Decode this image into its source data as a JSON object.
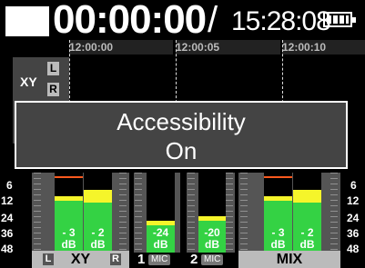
{
  "header": {
    "counter": "00:00:00",
    "separator": "/",
    "remaining": "15:28:08",
    "battery_icon": "battery-full-icon",
    "stop_icon": "stop-square-icon"
  },
  "timeline": {
    "ticks": [
      "12:00:00",
      "12:00:05",
      "12:00:10"
    ],
    "track_name": "XY",
    "left_badge": "L",
    "right_badge": "R"
  },
  "popup": {
    "line1": "Accessibility",
    "line2": "On"
  },
  "meters": {
    "scale_left": [
      "6",
      "12",
      "24",
      "36",
      "48"
    ],
    "scale_right": [
      "6",
      "12",
      "24",
      "36",
      "48"
    ],
    "channels": [
      {
        "level": "- 3",
        "unit": "dB",
        "fill": 0.7
      },
      {
        "level": "- 2",
        "unit": "dB",
        "fill": 0.78
      },
      {
        "level": "-24",
        "unit": "dB",
        "fill": 0.4
      },
      {
        "level": "-20",
        "unit": "dB",
        "fill": 0.46
      },
      {
        "level": "- 3",
        "unit": "dB",
        "fill": 0.7
      },
      {
        "level": "- 2",
        "unit": "dB",
        "fill": 0.78
      }
    ]
  },
  "labels": {
    "xy_left": "L",
    "xy_name": "XY",
    "xy_right": "R",
    "in1_num": "1",
    "in1_type": "MIC",
    "in2_num": "2",
    "in2_type": "MIC",
    "mix": "MIX"
  },
  "colors": {
    "meter_green": "#34d244",
    "meter_yellow": "#f5f52a",
    "peak_orange": "#ff5a1e",
    "popup_bg": "#444444"
  }
}
